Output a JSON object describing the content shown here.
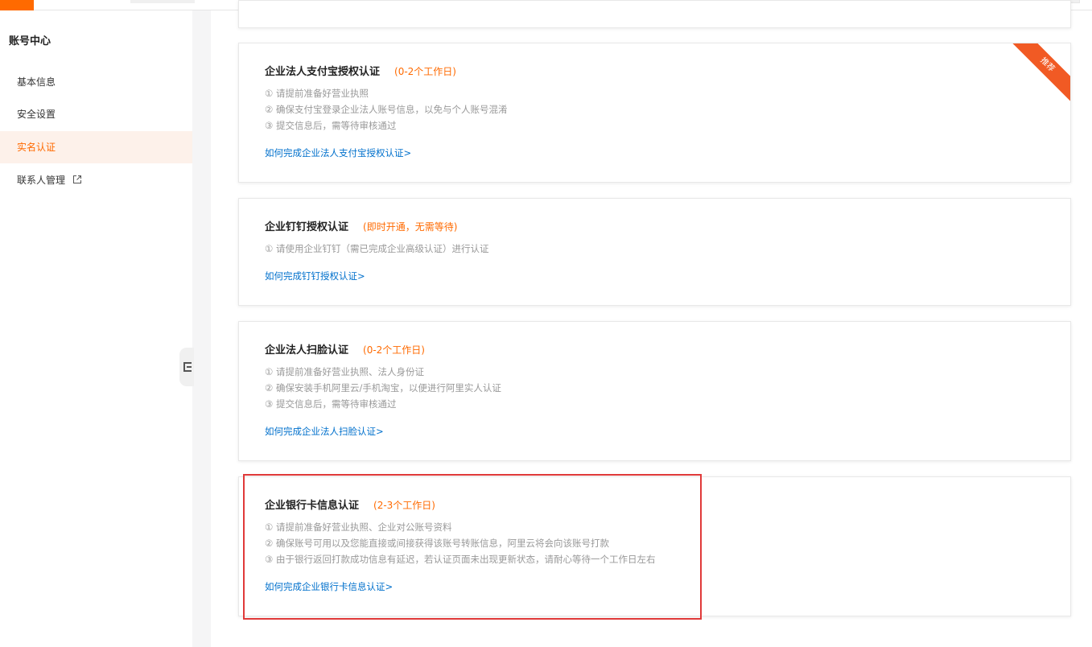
{
  "sidebar": {
    "title": "账号中心",
    "items": [
      {
        "label": "基本信息"
      },
      {
        "label": "安全设置"
      },
      {
        "label": "实名认证"
      },
      {
        "label": "联系人管理"
      }
    ]
  },
  "cards": [
    {
      "title": "企业法人支付宝授权认证",
      "note": "(0-2个工作日)",
      "steps": [
        "① 请提前准备好营业执照",
        "② 确保支付宝登录企业法人账号信息，以免与个人账号混淆",
        "③ 提交信息后，需等待审核通过"
      ],
      "link": "如何完成企业法人支付宝授权认证>",
      "badge": "推荐"
    },
    {
      "title": "企业钉钉授权认证",
      "note": "(即时开通，无需等待)",
      "steps": [
        "① 请使用企业钉钉（需已完成企业高级认证）进行认证"
      ],
      "link": "如何完成钉钉授权认证>"
    },
    {
      "title": "企业法人扫脸认证",
      "note": "(0-2个工作日)",
      "steps": [
        "① 请提前准备好营业执照、法人身份证",
        "② 确保安装手机阿里云/手机淘宝，以便进行阿里实人认证",
        "③ 提交信息后，需等待审核通过"
      ],
      "link": "如何完成企业法人扫脸认证>"
    },
    {
      "title": "企业银行卡信息认证",
      "note": "(2-3个工作日)",
      "steps": [
        "① 请提前准备好营业执照、企业对公账号资料",
        "② 确保账号可用以及您能直接或间接获得该账号转账信息，阿里云将会向该账号打款",
        "③ 由于银行返回打款成功信息有延迟，若认证页面未出现更新状态，请耐心等待一个工作日左右"
      ],
      "link": "如何完成企业银行卡信息认证>"
    }
  ],
  "colors": {
    "accent": "#ff6a00",
    "link": "#0070cc",
    "highlight": "#e03a3a",
    "ribbon": "#f15a24"
  }
}
